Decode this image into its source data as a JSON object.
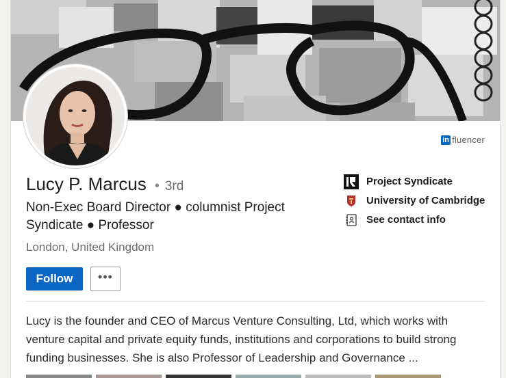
{
  "profile": {
    "name": "Lucy P. Marcus",
    "degree": "3rd",
    "separator": "•",
    "headline": "Non-Exec Board Director ● columnist Project Syndicate ● Professor",
    "location": "London, United Kingdom",
    "badge": {
      "logo": "in",
      "text": "fluencer"
    }
  },
  "actions": {
    "follow_label": "Follow",
    "more_label": "•••",
    "more_icon": "ellipsis-icon"
  },
  "side": {
    "items": [
      {
        "label": "Project Syndicate",
        "icon": "project-syndicate-logo-icon"
      },
      {
        "label": "University of Cambridge",
        "icon": "cambridge-crest-icon"
      },
      {
        "label": "See contact info",
        "icon": "address-book-icon"
      }
    ]
  },
  "summary": "Lucy is the founder and CEO of Marcus Venture Consulting, Ltd, which works with venture capital and private equity funds, institutions and corporations to build strong funding businesses. She is also Professor of Leadership and Governance ...",
  "colors": {
    "primary": "#0a66c2",
    "text": "#1d1d1d",
    "muted": "#6b6b6b"
  }
}
